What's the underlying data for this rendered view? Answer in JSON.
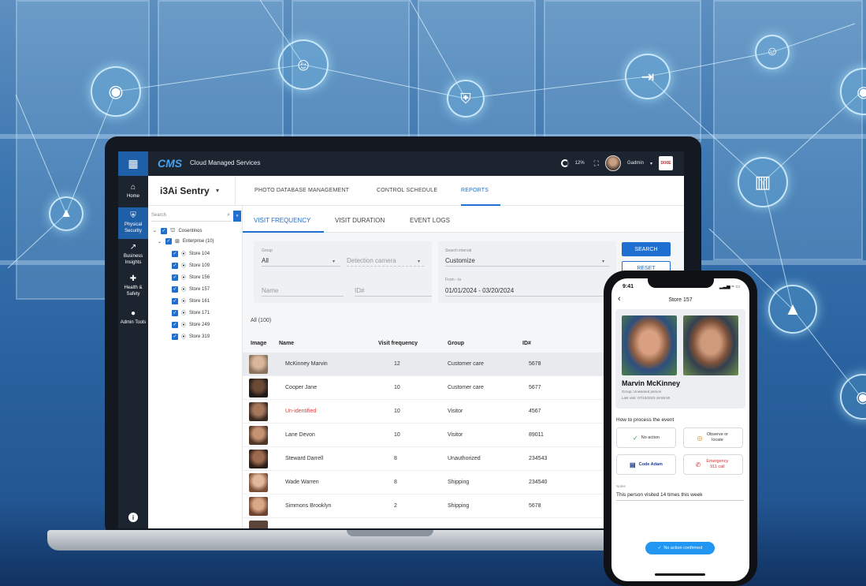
{
  "app": {
    "logo": "CMS",
    "title": "Cloud Managed Services",
    "cpu": "12%",
    "user": "Gadmin",
    "user_caret": "▾",
    "brand": "DIXIE"
  },
  "leftnav": {
    "grid_icon": "grid-icon",
    "items": [
      {
        "label": "Home",
        "icon": "home-icon",
        "glyph": "⌂"
      },
      {
        "label": "Physical Security",
        "icon": "shield-icon",
        "glyph": "⛨"
      },
      {
        "label": "Business Insights",
        "icon": "chart-icon",
        "glyph": "↗"
      },
      {
        "label": "Health & Safety",
        "icon": "plus-icon",
        "glyph": "✚"
      },
      {
        "label": "Admin Tools",
        "icon": "person-icon",
        "glyph": "●"
      }
    ],
    "info_glyph": "i"
  },
  "header": {
    "product": "i3Ai Sentry",
    "product_caret": "▾",
    "tabs": [
      "PHOTO DATABASE MANAGEMENT",
      "CONTROL SCHEDULE",
      "REPORTS"
    ]
  },
  "tree": {
    "search_placeholder": "Search",
    "search_glyph": "⌕",
    "collapse_glyph": "«",
    "root": "Cosentinos",
    "enterprise": "Enterprise (10)",
    "stores": [
      "Store 104",
      "Store 109",
      "Store 156",
      "Store 157",
      "Store 161",
      "Store 171",
      "Store 249",
      "Store 319"
    ]
  },
  "subtabs": [
    "VISIT FREQUENCY",
    "VISIT DURATION",
    "EVENT LOGS"
  ],
  "filters": {
    "group_label": "Group",
    "group_value": "All",
    "detection_placeholder": "Detection camera",
    "name_placeholder": "Name",
    "id_placeholder": "ID#",
    "interval_label": "Search interval",
    "interval_value": "Customize",
    "range_label": "From - to",
    "range_value": "01/01/2024 - 03/20/2024",
    "search_btn": "SEARCH",
    "reset_btn": "RESET"
  },
  "table": {
    "count": "All (100)",
    "headers": [
      "Image",
      "Name",
      "Visit frequency",
      "Group",
      "ID#"
    ],
    "rows": [
      {
        "name": "McKinney Marvin",
        "freq": "12",
        "group": "Customer care",
        "id": "5678"
      },
      {
        "name": "Cooper Jane",
        "freq": "10",
        "group": "Customer care",
        "id": "5677"
      },
      {
        "name": "Un-identified",
        "freq": "10",
        "group": "Visitor",
        "id": "4567"
      },
      {
        "name": "Lane Devon",
        "freq": "10",
        "group": "Visitor",
        "id": "89011"
      },
      {
        "name": "Steward Darrell",
        "freq": "8",
        "group": "Unauthorized",
        "id": "234543"
      },
      {
        "name": "Wade Warren",
        "freq": "8",
        "group": "Shipping",
        "id": "234540"
      },
      {
        "name": "Simmons Brooklyn",
        "freq": "2",
        "group": "Shipping",
        "id": "5678"
      }
    ]
  },
  "phone": {
    "time": "9:41",
    "status": "▂▃▅ ≈ ▭",
    "back_glyph": "‹",
    "title": "Store 157",
    "name": "Marvin McKinney",
    "group_line": "Group:  Unwanted person",
    "last_visit": "Last visit:  07/10/2023 18:55:50",
    "process_label": "How to process the event",
    "actions": [
      "No action",
      "Observe or locate",
      "Code Adam",
      "Emergency 911 call"
    ],
    "notes_label": "Notes",
    "notes": "This person visited 14 times this week",
    "toast": "No action confirmed",
    "toast_glyph": "✓"
  },
  "colors": {
    "accent": "#1f6fd0",
    "nav_dark": "#1c2430",
    "unidentified": "#e23b3b"
  }
}
